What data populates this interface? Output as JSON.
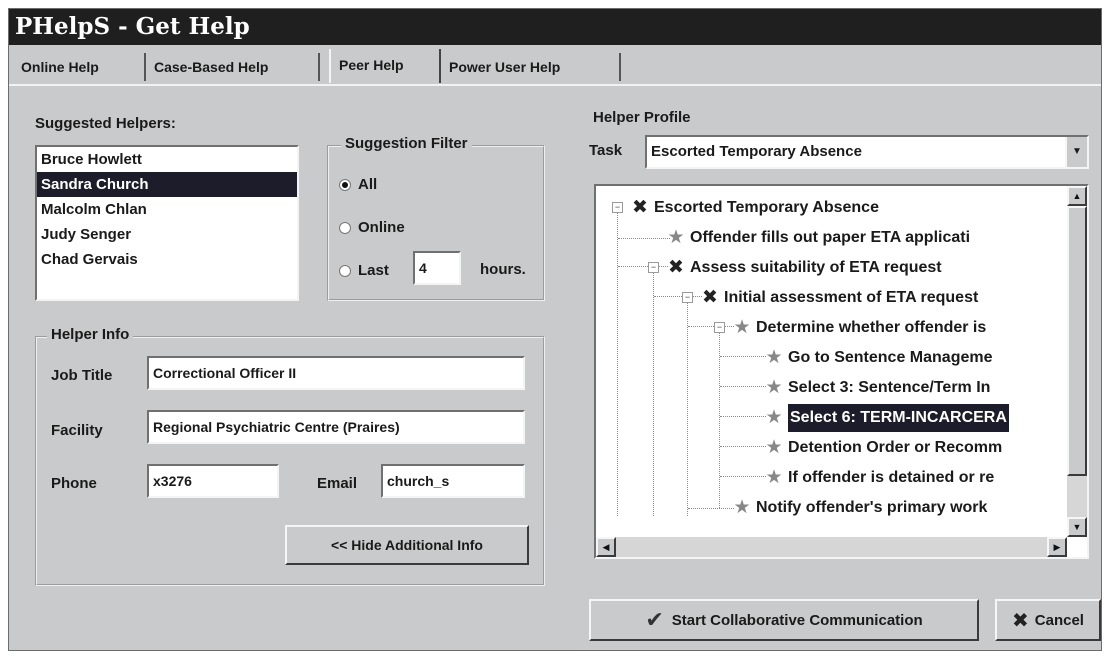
{
  "window": {
    "title": "PHelpS - Get Help"
  },
  "tabs": [
    {
      "label": "Online Help"
    },
    {
      "label": "Case-Based Help"
    },
    {
      "label": "Peer Help"
    },
    {
      "label": "Power User Help"
    }
  ],
  "active_tab": "Peer Help",
  "helpers": {
    "label": "Suggested Helpers:",
    "items": [
      "Bruce Howlett",
      "Sandra Church",
      "Malcolm Chlan",
      "Judy Senger",
      "Chad Gervais"
    ],
    "selected": "Sandra Church"
  },
  "filter": {
    "caption": "Suggestion Filter",
    "all_label": "All",
    "online_label": "Online",
    "last_label": "Last",
    "last_value": "4",
    "hours_label": "hours.",
    "selected": "All"
  },
  "helper_info": {
    "caption": "Helper Info",
    "job_title_label": "Job Title",
    "job_title": "Correctional Officer II",
    "facility_label": "Facility",
    "facility": "Regional Psychiatric Centre (Praires)",
    "phone_label": "Phone",
    "phone": "x3276",
    "email_label": "Email",
    "email": "church_s",
    "hide_button": "<< Hide Additional Info"
  },
  "profile": {
    "caption": "Helper Profile",
    "task_label": "Task",
    "task_value": "Escorted Temporary Absence",
    "tree": [
      {
        "label": "Escorted Temporary Absence",
        "icon": "x-mark-icon"
      },
      {
        "label": "Offender fills out paper ETA applicati",
        "icon": "star-icon"
      },
      {
        "label": "Assess suitability of ETA request",
        "icon": "x-mark-icon"
      },
      {
        "label": "Initial assessment of ETA request",
        "icon": "x-mark-icon"
      },
      {
        "label": "Determine whether offender is",
        "icon": "star-icon"
      },
      {
        "label": "Go to Sentence Manageme",
        "icon": "star-icon"
      },
      {
        "label": "Select 3: Sentence/Term In",
        "icon": "star-icon"
      },
      {
        "label": "Select 6: TERM-INCARCERA",
        "icon": "star-icon",
        "selected": true
      },
      {
        "label": "Detention Order or Recomm",
        "icon": "star-icon"
      },
      {
        "label": "If offender is detained or re",
        "icon": "star-icon"
      },
      {
        "label": "Notify offender's primary work",
        "icon": "star-icon"
      }
    ]
  },
  "buttons": {
    "start": "Start Collaborative Communication",
    "cancel": "Cancel"
  }
}
